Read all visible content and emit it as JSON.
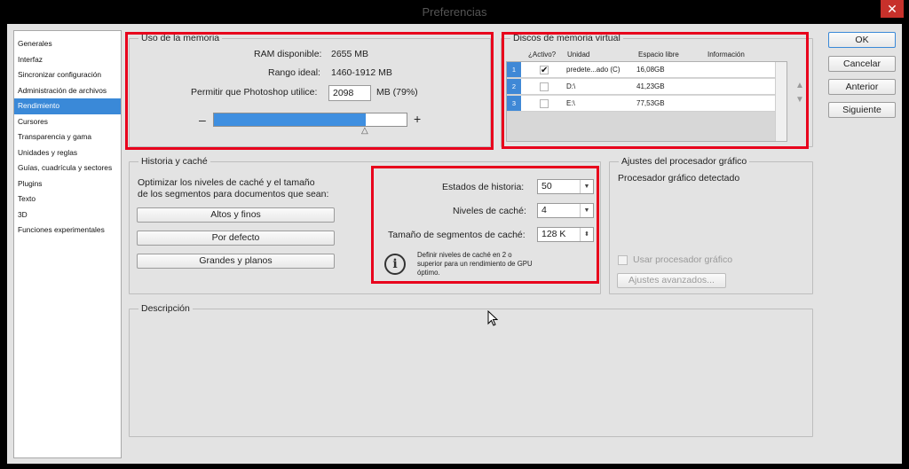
{
  "window": {
    "title": "Preferencias",
    "close_glyph": "✕"
  },
  "sidebar": {
    "items": [
      {
        "label": "Generales"
      },
      {
        "label": "Interfaz"
      },
      {
        "label": "Sincronizar configuración"
      },
      {
        "label": "Administración de archivos"
      },
      {
        "label": "Rendimiento",
        "selected": true
      },
      {
        "label": "Cursores"
      },
      {
        "label": "Transparencia y gama"
      },
      {
        "label": "Unidades y reglas"
      },
      {
        "label": "Guías, cuadrícula y sectores"
      },
      {
        "label": "Plugins"
      },
      {
        "label": "Texto"
      },
      {
        "label": "3D"
      },
      {
        "label": "Funciones experimentales"
      }
    ]
  },
  "memory": {
    "title": "Uso de la memoria",
    "ram_label": "RAM disponible:",
    "ram_value": "2655 MB",
    "range_label": "Rango ideal:",
    "range_value": "1460-1912 MB",
    "allow_label": "Permitir que Photoshop utilice:",
    "allow_value": "2098",
    "allow_unit": "MB (79%)",
    "slider_fraction": 0.79,
    "minus": "–",
    "plus": "+"
  },
  "scratch": {
    "title": "Discos de memoria virtual",
    "headers": {
      "active": "¿Activo?",
      "unit": "Unidad",
      "free": "Espacio libre",
      "info": "Información"
    },
    "rows": [
      {
        "num": "1",
        "active": true,
        "unit": "predete...ado (C)",
        "free": "16,08GB"
      },
      {
        "num": "2",
        "active": false,
        "unit": "D:\\",
        "free": "41,23GB"
      },
      {
        "num": "3",
        "active": false,
        "unit": "E:\\",
        "free": "77,53GB"
      }
    ]
  },
  "history": {
    "title": "Historia y caché",
    "optimize_line1": "Optimizar los niveles de caché y el tamaño",
    "optimize_line2": "de los segmentos para documentos que sean:",
    "btn_tall": "Altos y finos",
    "btn_default": "Por defecto",
    "btn_large": "Grandes y planos",
    "states_label": "Estados de historia:",
    "states_value": "50",
    "levels_label": "Niveles de caché:",
    "levels_value": "4",
    "tile_label": "Tamaño de segmentos de caché:",
    "tile_value": "128 K",
    "info_line1": "Definir niveles de caché en 2 o",
    "info_line2": "superior para un rendimiento de GPU",
    "info_line3": "óptimo."
  },
  "gpu": {
    "title": "Ajustes del procesador gráfico",
    "detected": "Procesador gráfico detectado",
    "use_label": "Usar procesador gráfico",
    "advanced": "Ajustes avanzados..."
  },
  "description": {
    "title": "Descripción"
  },
  "actions": {
    "ok": "OK",
    "cancel": "Cancelar",
    "prev": "Anterior",
    "next": "Siguiente"
  },
  "colors": {
    "accent": "#3a89d8",
    "highlight": "#e8001c"
  }
}
